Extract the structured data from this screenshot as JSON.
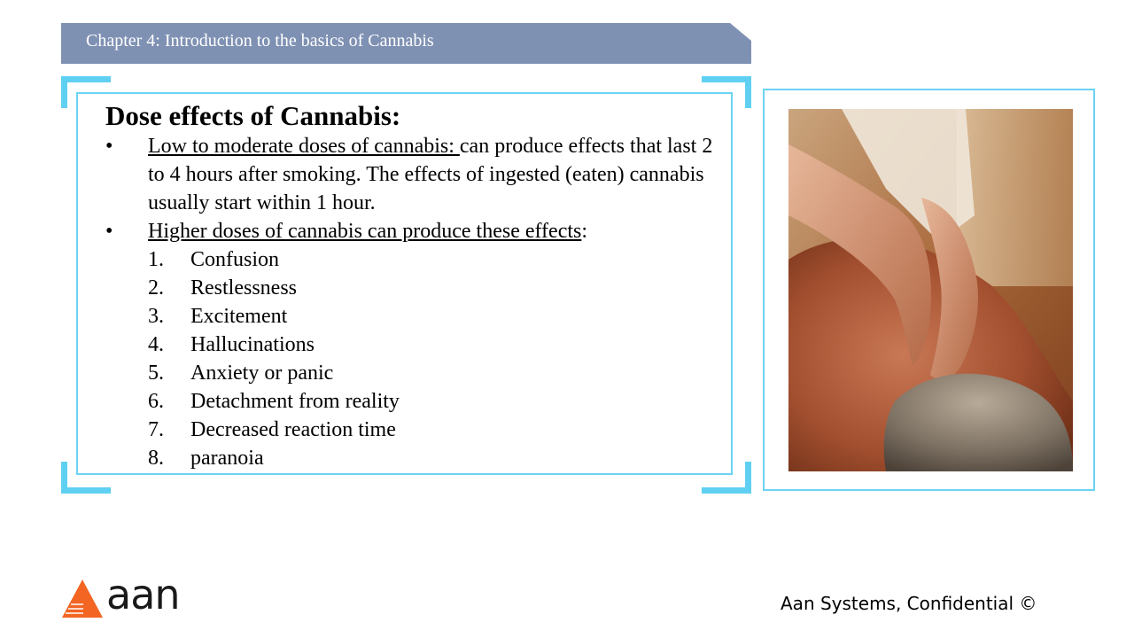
{
  "header": {
    "title": "Chapter 4: Introduction to the basics of Cannabis"
  },
  "content": {
    "heading": "Dose effects of Cannabis:",
    "bullet_glyph": "•",
    "bullet1": {
      "underlined": "Low to moderate doses of cannabis:  ",
      "rest": "can produce effects that last 2 to 4 hours after smoking.  The effects of ingested (eaten) cannabis usually start within 1 hour."
    },
    "bullet2": {
      "underlined": "Higher doses of cannabis can produce these effects",
      "rest": ":"
    },
    "effects": [
      {
        "num": "1.",
        "text": "Confusion"
      },
      {
        "num": "2.",
        "text": "Restlessness"
      },
      {
        "num": "3.",
        "text": "Excitement"
      },
      {
        "num": "4.",
        "text": "Hallucinations"
      },
      {
        "num": "5.",
        "text": "Anxiety or panic"
      },
      {
        "num": "6.",
        "text": "Detachment from reality"
      },
      {
        "num": "7.",
        "text": "Decreased reaction time"
      },
      {
        "num": "8.",
        "text": "paranoia"
      }
    ]
  },
  "footer": {
    "logo_text": "aan",
    "confidential": "Aan Systems, Confidential ©"
  },
  "colors": {
    "banner": "#7f91b3",
    "frame_accent": "#5fd0f2",
    "logo_orange": "#f26522"
  }
}
